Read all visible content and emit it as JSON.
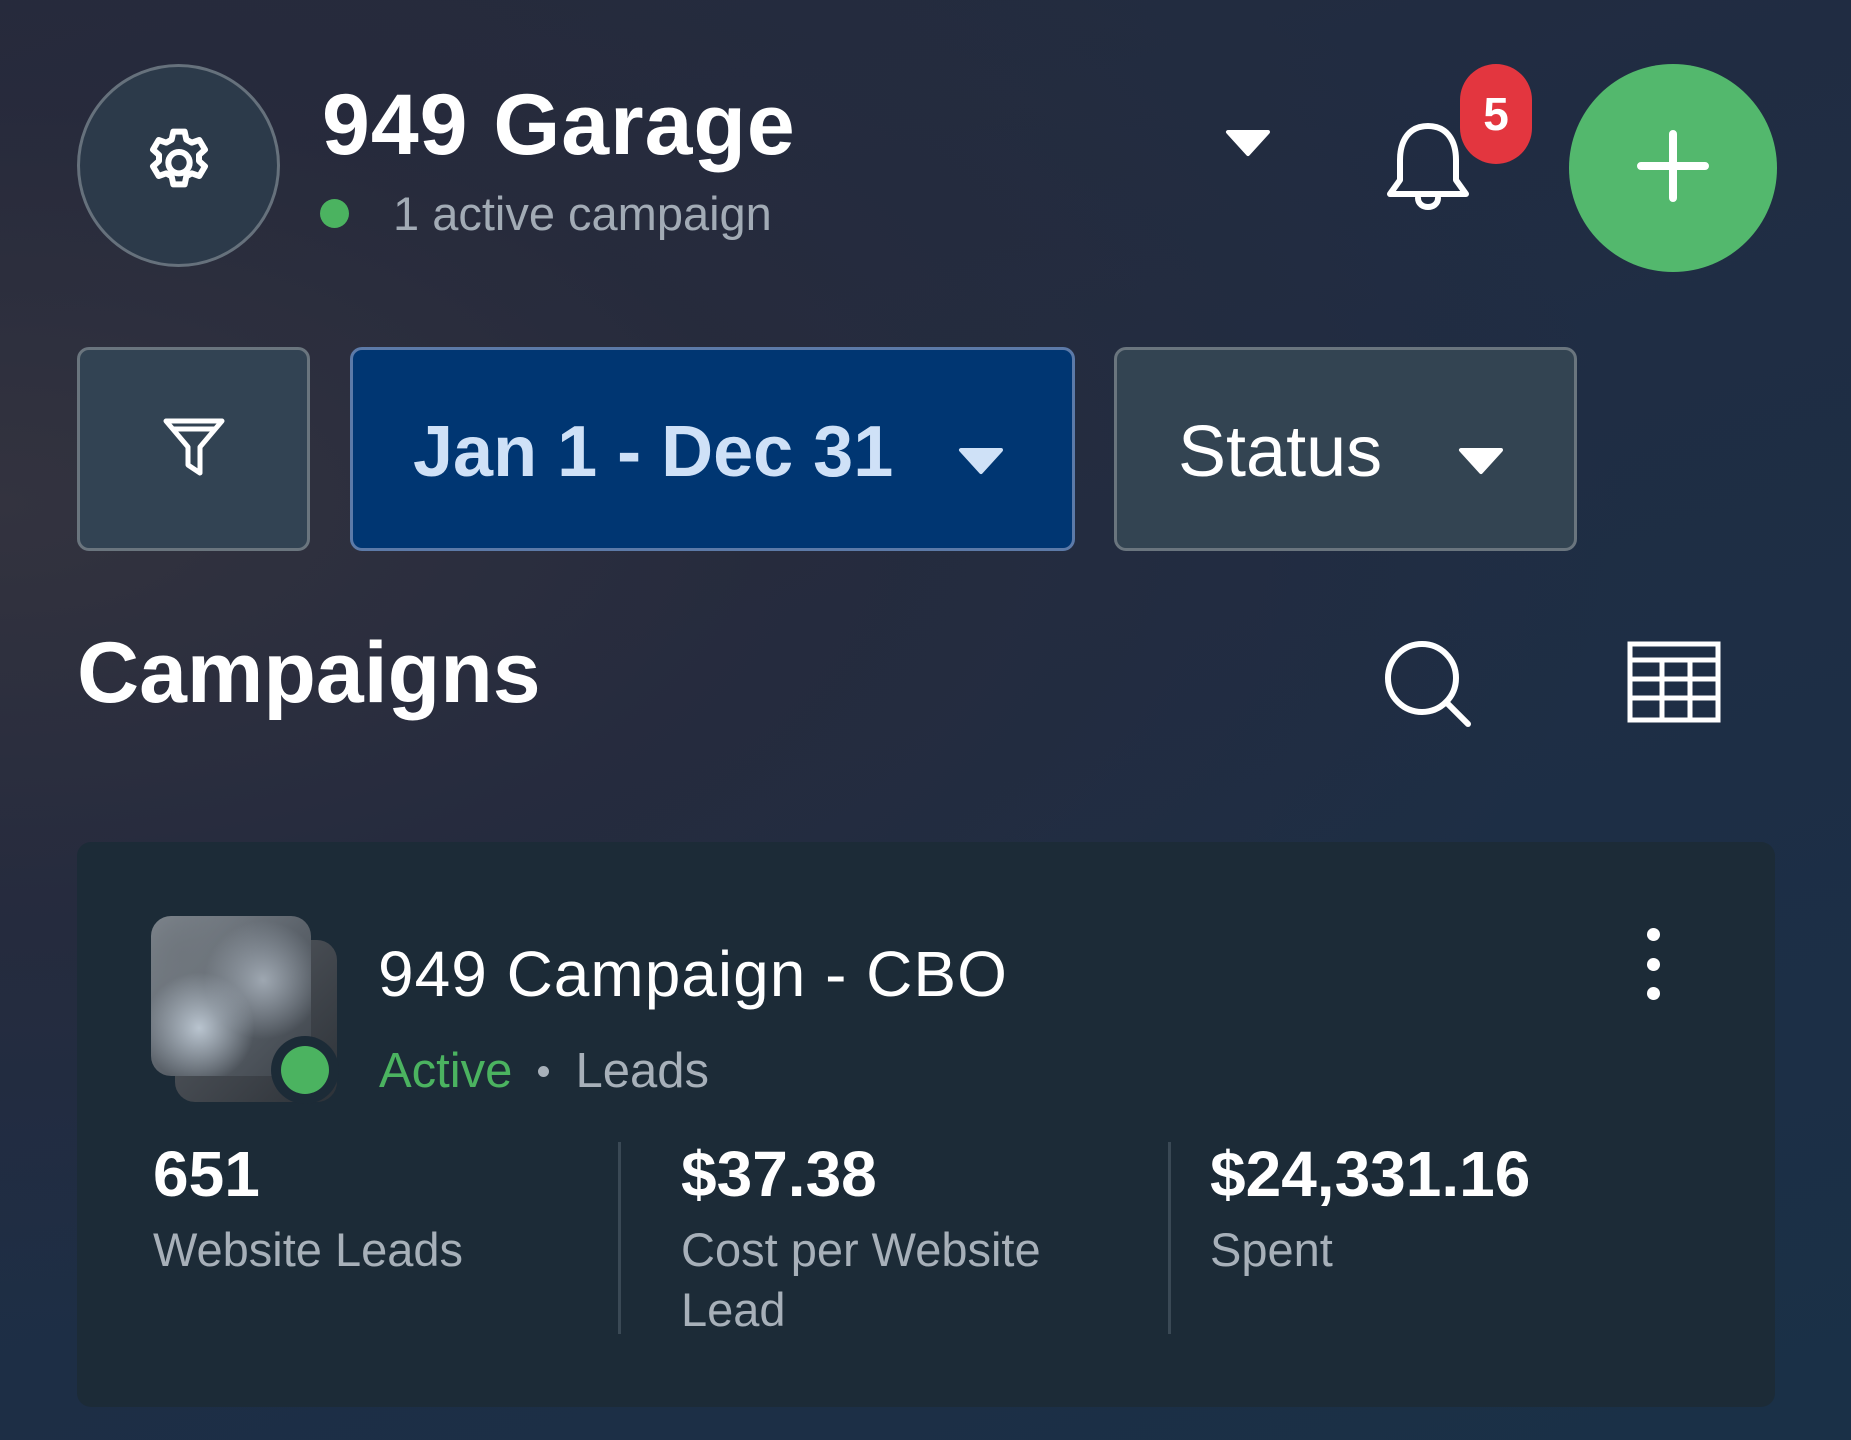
{
  "header": {
    "account_name": "949 Garage",
    "active_campaigns_text": "1 active campaign",
    "notification_count": "5",
    "settings_icon": "gear-icon",
    "dropdown_icon": "caret-down-icon",
    "notifications_icon": "bell-icon",
    "add_icon": "plus-icon"
  },
  "filters": {
    "filter_icon": "funnel-icon",
    "date_range": "Jan 1 - Dec 31",
    "status_label": "Status"
  },
  "campaigns_section": {
    "title": "Campaigns",
    "search_icon": "search-icon",
    "table_icon": "table-icon"
  },
  "campaign": {
    "name": "949 Campaign - CBO",
    "status": "Active",
    "objective": "Leads",
    "metrics": [
      {
        "value": "651",
        "label": "Website Leads"
      },
      {
        "value": "$37.38",
        "label": "Cost per Website Lead"
      },
      {
        "value": "$24,331.16",
        "label": "Spent"
      }
    ]
  },
  "colors": {
    "accent_green": "#53b86d",
    "badge_red": "#e3363f",
    "date_button_bg": "#003672",
    "date_text": "#cfe1f7",
    "card_bg": "#1c2b37"
  }
}
